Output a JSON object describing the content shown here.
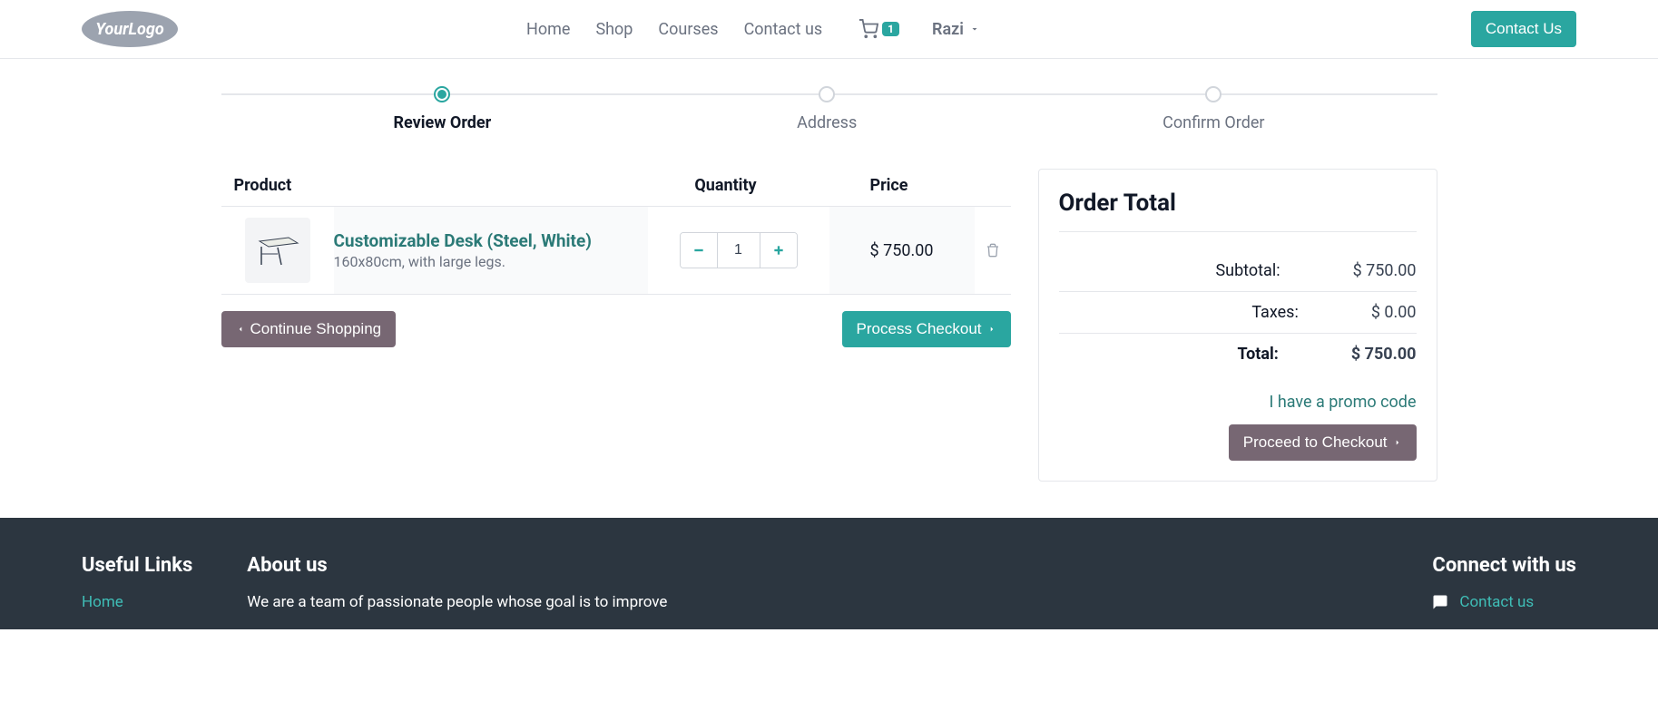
{
  "brand": {
    "logo_text": "YourLogo"
  },
  "nav": {
    "home": "Home",
    "shop": "Shop",
    "courses": "Courses",
    "contact_us": "Contact us"
  },
  "header": {
    "cart_count": "1",
    "user_name": "Razi",
    "contact_btn": "Contact Us"
  },
  "wizard": {
    "step1": "Review Order",
    "step2": "Address",
    "step3": "Confirm Order"
  },
  "cart": {
    "headers": {
      "product": "Product",
      "quantity": "Quantity",
      "price": "Price"
    },
    "items": [
      {
        "name": "Customizable Desk (Steel, White)",
        "desc": "160x80cm, with large legs.",
        "qty": "1",
        "price": "$ 750.00"
      }
    ],
    "continue_btn": "Continue Shopping",
    "process_btn": "Process Checkout"
  },
  "totals": {
    "title": "Order Total",
    "subtotal_label": "Subtotal:",
    "subtotal_value": "$ 750.00",
    "taxes_label": "Taxes:",
    "taxes_value": "$ 0.00",
    "total_label": "Total:",
    "total_value": "$ 750.00",
    "promo_link": "I have a promo code",
    "proceed_btn": "Proceed to Checkout"
  },
  "footer": {
    "useful_title": "Useful Links",
    "useful_home": "Home",
    "about_title": "About us",
    "about_text": "We are a team of passionate people whose goal is to improve",
    "connect_title": "Connect with us",
    "connect_contact": "Contact us"
  }
}
